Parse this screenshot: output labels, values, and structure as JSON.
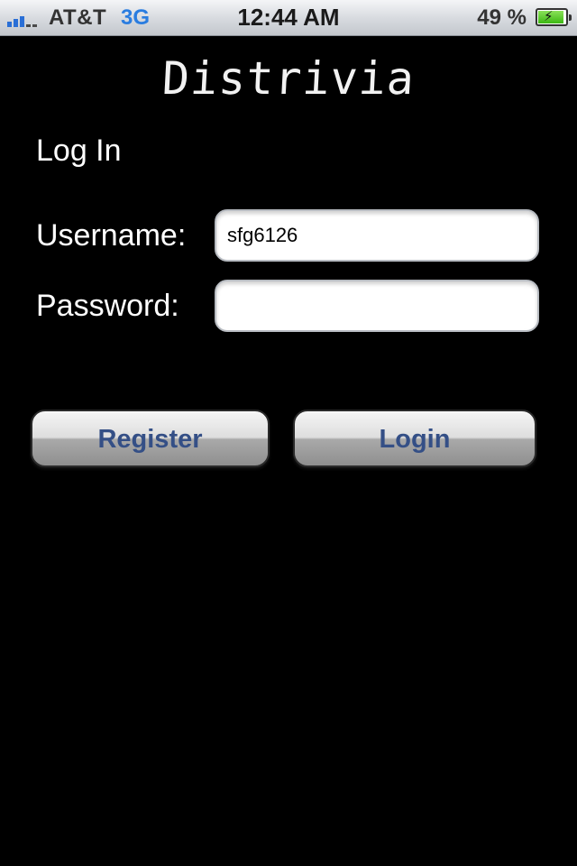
{
  "status_bar": {
    "carrier": "AT&T",
    "network": "3G",
    "time": "12:44 AM",
    "battery_percent": "49 %",
    "icons": [
      "signal-bars-icon",
      "battery-charging-icon"
    ]
  },
  "app": {
    "title": "Distrivia"
  },
  "login": {
    "heading": "Log In",
    "username_label": "Username:",
    "username_value": "sfg6126",
    "password_label": "Password:",
    "password_value": "",
    "register_label": "Register",
    "login_label": "Login"
  },
  "colors": {
    "background": "#000000",
    "button_text": "#344f86",
    "network_text": "#2a7de0"
  }
}
